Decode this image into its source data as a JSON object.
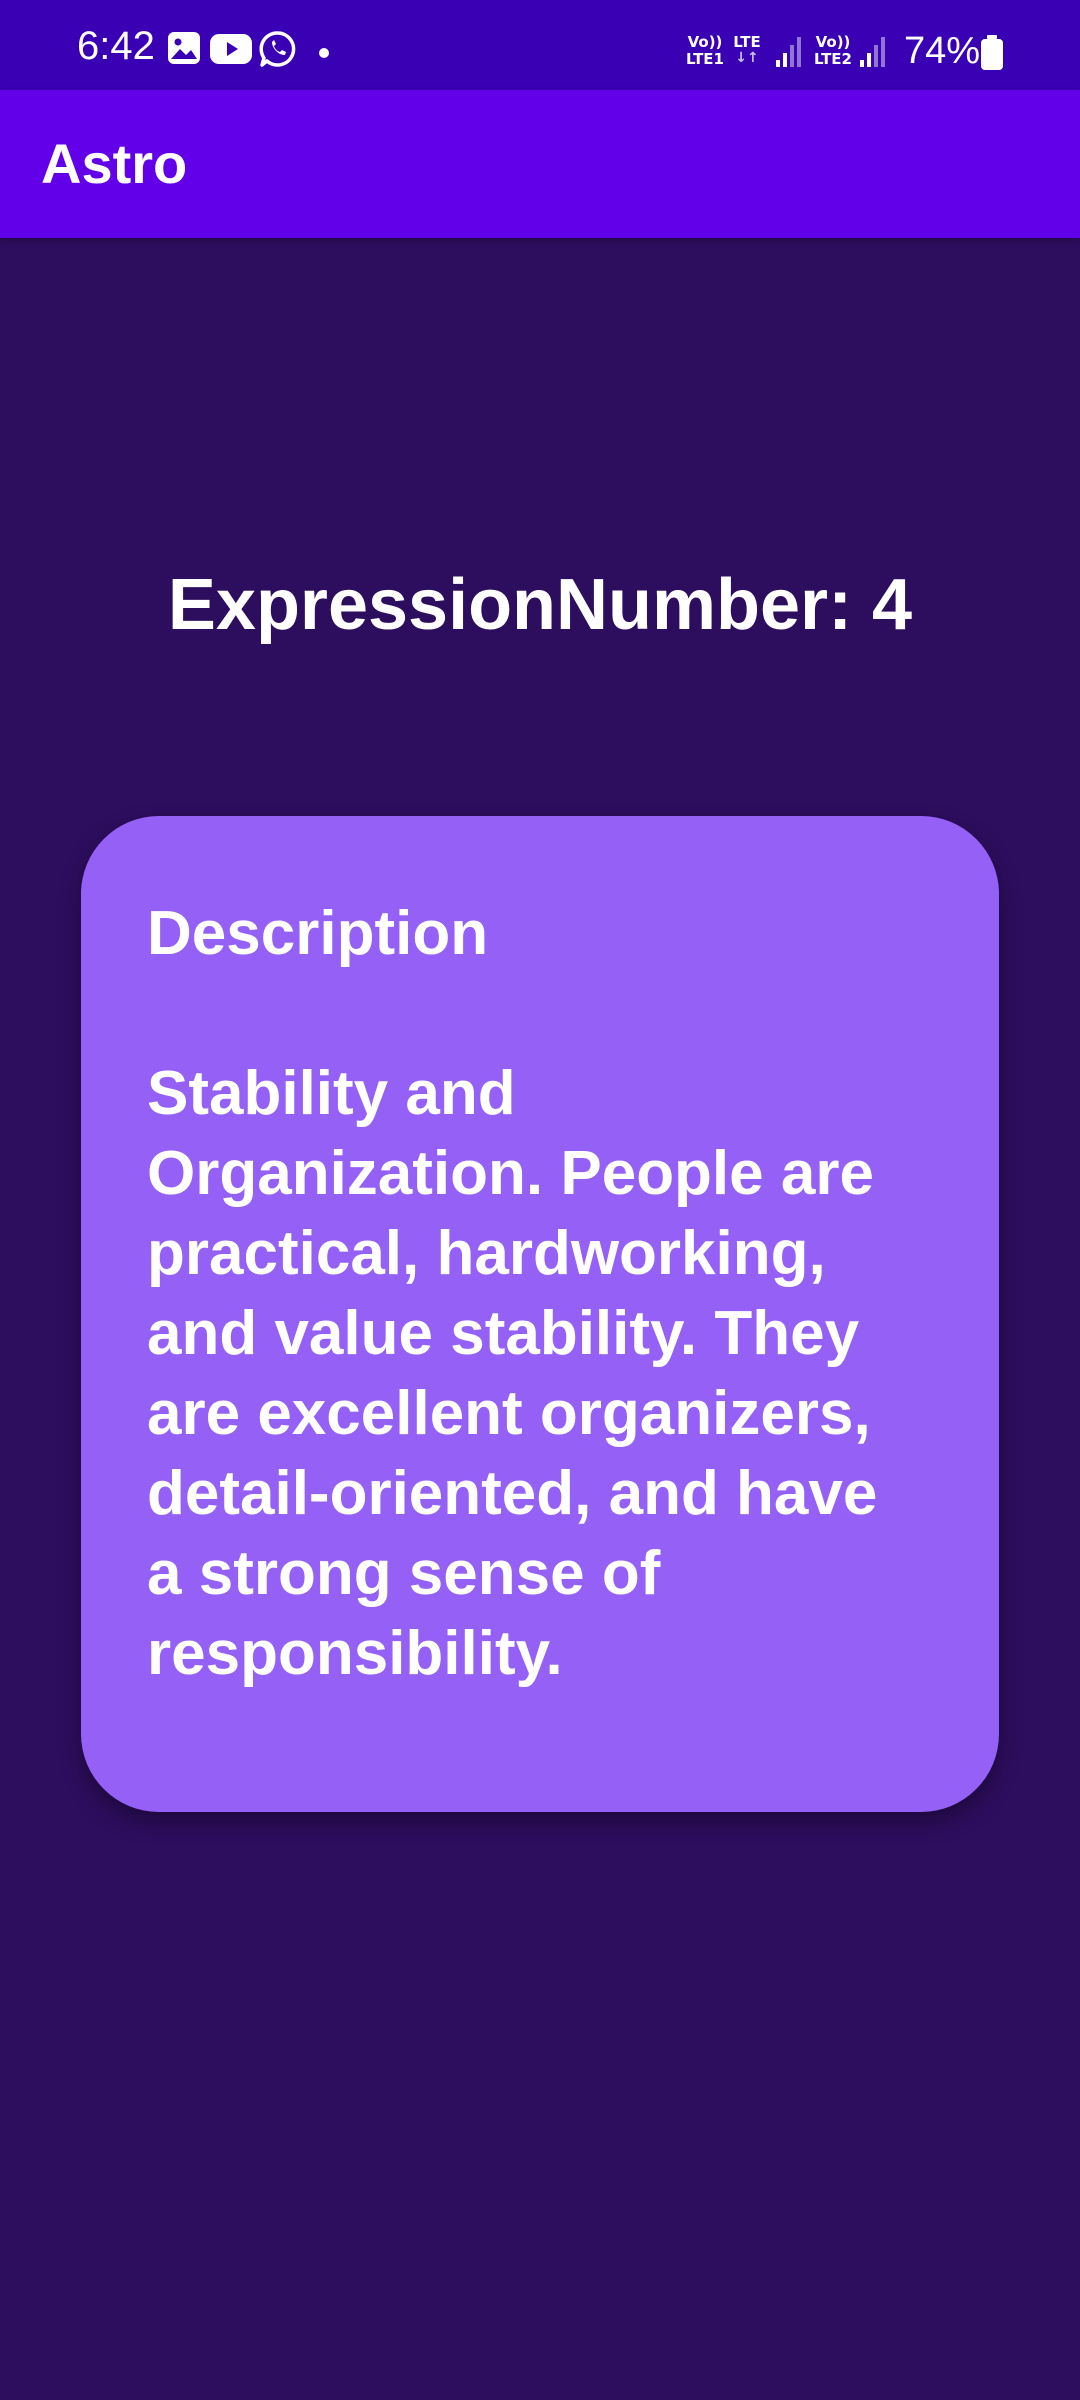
{
  "status_bar": {
    "time": "6:42",
    "notification_icons": [
      "gallery-icon",
      "youtube-icon",
      "whatsapp-icon"
    ],
    "sim1": {
      "top": "Vo))",
      "bottom": "LTE1"
    },
    "data": {
      "top": "LTE",
      "arrows": "↓↑"
    },
    "sim2": {
      "top": "Vo))",
      "bottom": "LTE2"
    },
    "battery": "74%"
  },
  "app_bar": {
    "title": "Astro"
  },
  "main": {
    "heading": "ExpressionNumber: 4",
    "card": {
      "title": "Description",
      "text": "Stability and Organization. People are practical, hardworking, and value stability. They are excellent organizers, detail-oriented, and have a strong sense of responsibility."
    }
  },
  "colors": {
    "status_bar": "#3a00b4",
    "app_bar": "#6200ea",
    "background": "#2d0d5e",
    "card": "#9560f5",
    "text": "#ffffff"
  }
}
